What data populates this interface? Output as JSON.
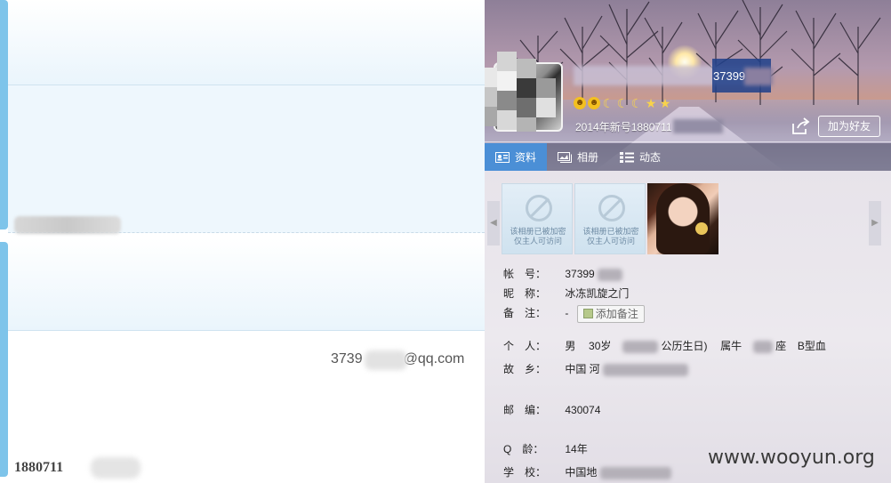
{
  "left": {
    "email_suffix": "@qq.com",
    "email_prefix": "3739",
    "phone_prefix": "1880711"
  },
  "profile": {
    "qq_number": "37399",
    "signature": "2014年新号1880711",
    "add_friend_label": "加为好友",
    "level_icons": [
      "sun",
      "sun",
      "moon",
      "moon",
      "moon",
      "star",
      "star"
    ],
    "tabs": [
      {
        "label": "资料",
        "icon": "profile-card-icon",
        "active": true
      },
      {
        "label": "相册",
        "icon": "album-icon",
        "active": false
      },
      {
        "label": "动态",
        "icon": "feed-list-icon",
        "active": false
      }
    ],
    "photos": [
      {
        "type": "placeholder",
        "text": "该相册已被加密\n仅主人可访问"
      },
      {
        "type": "placeholder",
        "text": "该相册已被加密\n仅主人可访问"
      },
      {
        "type": "portrait"
      }
    ],
    "info": {
      "account": {
        "label": "帐　号：",
        "value": "37399"
      },
      "nickname": {
        "label": "昵　称：",
        "value": "冰冻凯旋之门"
      },
      "remark": {
        "label": "备　注：",
        "value": "-",
        "button": "添加备注"
      },
      "personal": {
        "label": "个　人：",
        "gender": "男",
        "age": "30岁",
        "birthday_suffix": "公历生日)",
        "zodiac": "属牛",
        "constellation_suffix": "座",
        "blood": "B型血"
      },
      "hometown": {
        "label": "故　乡：",
        "value": "中国 河"
      },
      "postcode": {
        "label": "邮　编：",
        "value": "430074"
      },
      "qage": {
        "label": "Q　龄：",
        "value": "14年"
      },
      "school": {
        "label": "学　校：",
        "value": "中国地"
      }
    }
  },
  "watermark": "www.wooyun.org",
  "colors": {
    "accent_blue": "#4b8fd6",
    "left_accent": "#7ec4ea"
  }
}
